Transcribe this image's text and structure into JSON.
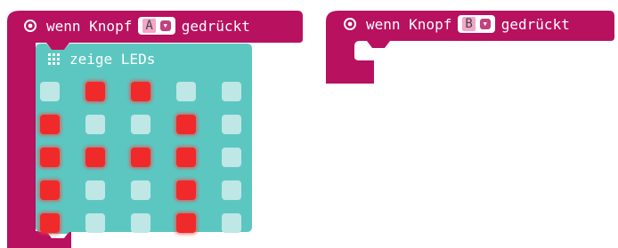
{
  "colors": {
    "event_block": "#b8115f",
    "leds_block": "#5cc7c1",
    "led_on": "#f02a2a",
    "led_off": "#bfe7e6"
  },
  "event_a": {
    "icon": "target-icon",
    "prefix": "wenn Knopf",
    "button_value": "A",
    "suffix": "gedrückt"
  },
  "event_b": {
    "icon": "target-icon",
    "prefix": "wenn Knopf",
    "button_value": "B",
    "suffix": "gedrückt"
  },
  "show_leds": {
    "icon": "grid-icon",
    "label": "zeige LEDs",
    "grid": [
      [
        0,
        1,
        1,
        0,
        0
      ],
      [
        1,
        0,
        0,
        1,
        0
      ],
      [
        1,
        1,
        1,
        1,
        0
      ],
      [
        1,
        0,
        0,
        1,
        0
      ],
      [
        1,
        0,
        0,
        1,
        0
      ]
    ]
  }
}
